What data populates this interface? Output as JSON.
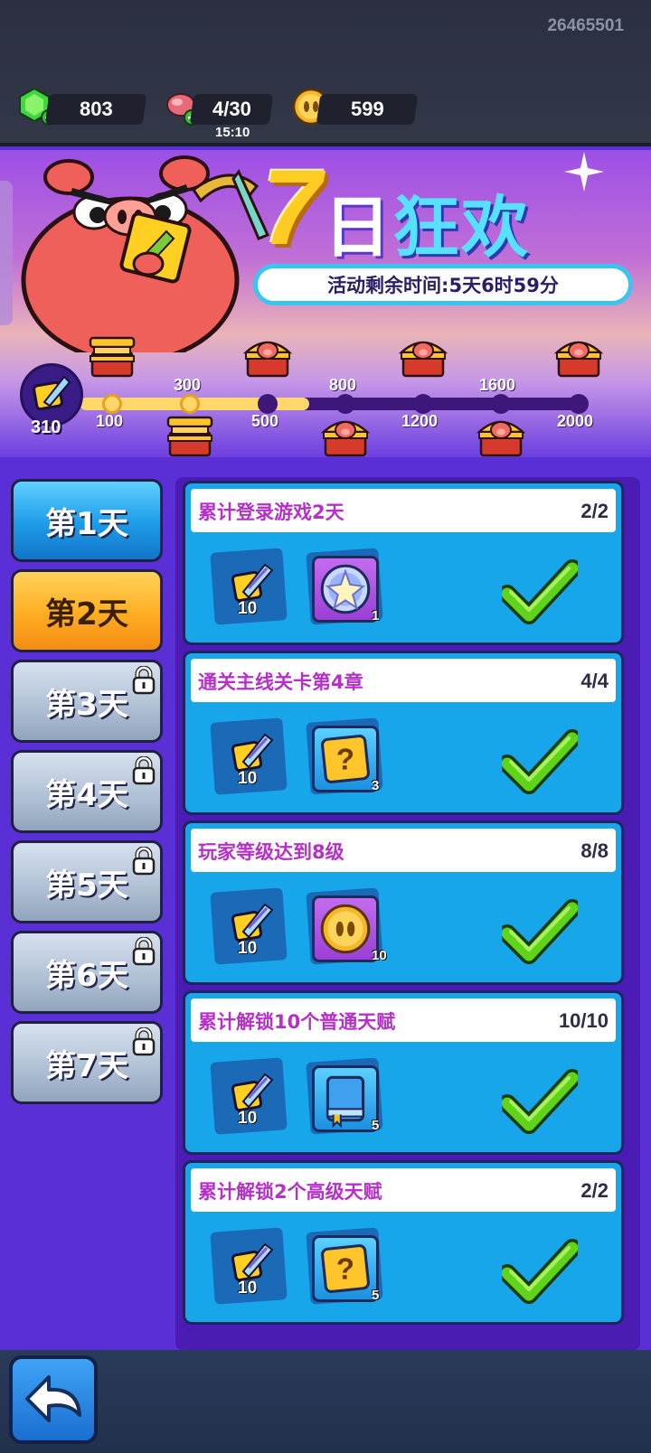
{
  "header": {
    "uid": "26465501",
    "gems": "803",
    "energy": "4/30",
    "energy_timer": "15:10",
    "coins": "599"
  },
  "banner": {
    "title_number": "7",
    "title_rest_1": "日",
    "title_rest_2": "狂欢",
    "countdown": "活动剩余时间:5天6时59分"
  },
  "progress": {
    "current_points": "310",
    "milestones": [
      {
        "value": "100",
        "done": true
      },
      {
        "value": "300",
        "done": true
      },
      {
        "value": "500",
        "done": false
      },
      {
        "value": "800",
        "done": false
      },
      {
        "value": "1200",
        "done": false
      },
      {
        "value": "1600",
        "done": false
      },
      {
        "value": "2000",
        "done": false
      }
    ],
    "fraction": 0.21
  },
  "days": [
    {
      "label": "第1天",
      "state": "blue",
      "locked": false
    },
    {
      "label": "第2天",
      "state": "selected",
      "locked": false
    },
    {
      "label": "第3天",
      "state": "grey",
      "locked": true
    },
    {
      "label": "第4天",
      "state": "grey",
      "locked": true
    },
    {
      "label": "第5天",
      "state": "grey",
      "locked": true
    },
    {
      "label": "第6天",
      "state": "grey",
      "locked": true
    },
    {
      "label": "第7天",
      "state": "grey",
      "locked": true
    }
  ],
  "tasks": [
    {
      "title": "累计登录游戏2天",
      "progress": "2/2",
      "points": "10",
      "reward_icon": "star-gem-icon",
      "reward_count": "1",
      "completed": true
    },
    {
      "title": "通关主线关卡第4章",
      "progress": "4/4",
      "points": "10",
      "reward_icon": "mystery-box-icon",
      "reward_count": "3",
      "completed": true
    },
    {
      "title": "玩家等级达到8级",
      "progress": "8/8",
      "points": "10",
      "reward_icon": "coin-icon",
      "reward_count": "10",
      "completed": true
    },
    {
      "title": "累计解锁10个普通天赋",
      "progress": "10/10",
      "points": "10",
      "reward_icon": "book-icon",
      "reward_count": "5",
      "completed": true
    },
    {
      "title": "累计解锁2个高级天赋",
      "progress": "2/2",
      "points": "10",
      "reward_icon": "mystery-box-icon",
      "reward_count": "5",
      "completed": true
    }
  ],
  "colors": {
    "background": "#5a2fd6",
    "task_card": "#17a6ea",
    "task_title": "#b62fc9",
    "check": "#5fd21a",
    "selected_tab": "#ffad22"
  }
}
